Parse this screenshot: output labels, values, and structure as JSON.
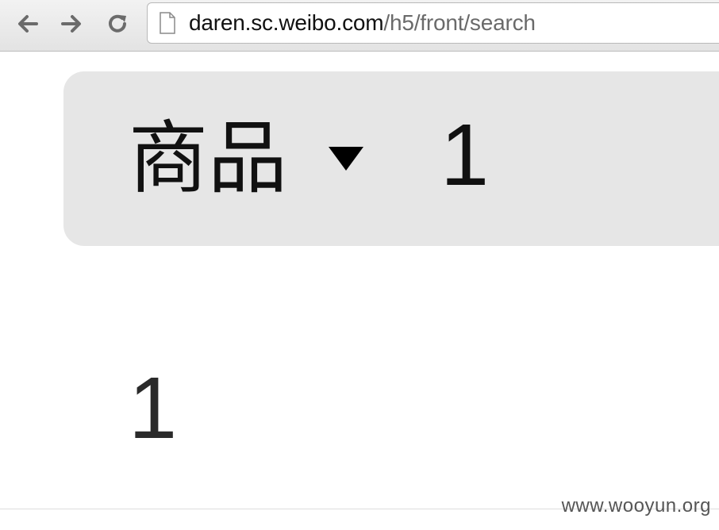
{
  "browser": {
    "url_host": "daren.sc.weibo.com",
    "url_path": "/h5/front/search",
    "back_icon": "arrow-left-icon",
    "forward_icon": "arrow-right-icon",
    "reload_icon": "reload-icon",
    "page_icon": "document-icon"
  },
  "search": {
    "category_label": "商品",
    "dropdown_icon": "caret-down-icon",
    "query_value": "1",
    "background_color": "#e6e6e6"
  },
  "results": {
    "text": "1"
  },
  "watermark": {
    "text": "www.wooyun.org"
  }
}
